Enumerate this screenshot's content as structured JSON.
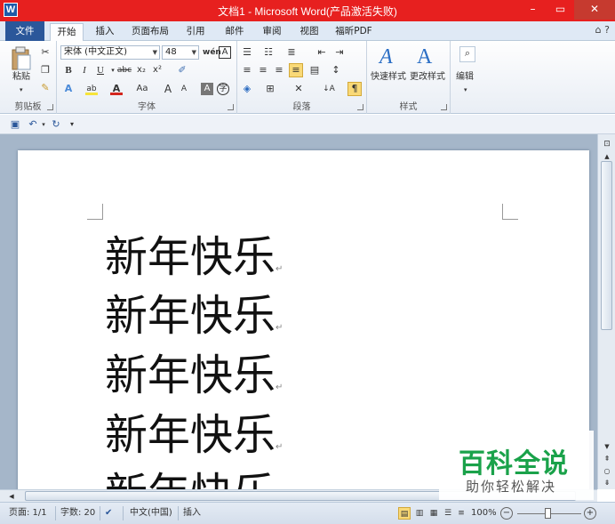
{
  "window": {
    "title": "文档1 - Microsoft Word(产品激活失败)",
    "minimize": "–",
    "maximize": "▭",
    "close": "✕"
  },
  "tabs": {
    "file": "文件",
    "home": "开始",
    "insert": "插入",
    "page_layout": "页面布局",
    "references": "引用",
    "mailings": "邮件",
    "review": "审阅",
    "view": "视图",
    "foxit": "福昕PDF"
  },
  "ribbon": {
    "clipboard": {
      "paste": "粘贴",
      "label": "剪贴板"
    },
    "font": {
      "font_name": "宋体 (中文正文)",
      "font_size": "48",
      "label": "字体",
      "bold": "B",
      "italic": "I",
      "underline": "U",
      "strike": "abc",
      "subscript": "x₂",
      "superscript": "x²",
      "aa": "Aa",
      "grow": "A",
      "shrink": "A"
    },
    "paragraph": {
      "label": "段落"
    },
    "styles": {
      "quick_styles": "快速样式",
      "change_styles": "更改样式",
      "label": "样式"
    },
    "editing": {
      "label": "编辑"
    }
  },
  "document": {
    "lines": [
      "新年快乐",
      "新年快乐",
      "新年快乐",
      "新年快乐",
      "新年快乐"
    ],
    "paragraph_mark": "↵"
  },
  "statusbar": {
    "page": "页面: 1/1",
    "words": "字数: 20",
    "language": "中文(中国)",
    "insert_mode": "插入",
    "zoom": "100%"
  },
  "watermark": {
    "main": "百科全说",
    "sub": "助你轻松解决"
  },
  "colors": {
    "titlebar": "#e7201f",
    "file_tab": "#2b579a",
    "doc_background": "#a5b6c9",
    "watermark_green": "#1aa24a"
  }
}
